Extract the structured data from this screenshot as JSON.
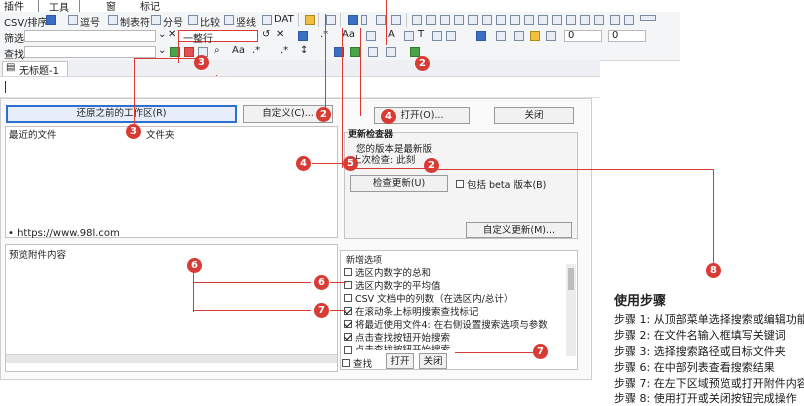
{
  "top_menu": {
    "item1": "插件",
    "item2": "工具",
    "item3": "窗",
    "item4": "标记"
  },
  "toolbar1": {
    "csv_label": "CSV/排序",
    "items": [
      "逗号",
      "制表符",
      "分号",
      "比较",
      "竖线",
      "DAT"
    ]
  },
  "filter_row": {
    "label": "筛选"
  },
  "find_row": {
    "label": "查找",
    "dropdown_value": "一整行"
  },
  "tab": {
    "label": "无标题-1"
  },
  "main": {
    "restore_button": "还原之前的工作区(R)",
    "custom_button": "自定义(C)...",
    "open_button": "打开(O)...",
    "close_button": "关闭",
    "recent_files_label": "最近的文件",
    "folder_label": "文件夹",
    "url_text": "• https://www.98l.com",
    "update_checker": {
      "title": "更新检查器",
      "latest_text": "您的版本是最新版",
      "last_check_text": "上次检查: 此刻",
      "check_button": "检查更新(U)",
      "beta_label": "包括 beta 版本(B)",
      "custom_update_button": "自定义更新(M)..."
    },
    "preview_label": "预览附件内容",
    "options": {
      "title": "新增选项",
      "items": [
        {
          "label": "选区内数字的总和",
          "checked": false
        },
        {
          "label": "选区内数字的平均值",
          "checked": false
        },
        {
          "label": "CSV 文档中的列数（在选区内/总计）",
          "checked": false
        },
        {
          "label": "在滚动条上标明搜索查找标记",
          "checked": true
        },
        {
          "label": "将最近使用文件4: 在右侧设置搜索选项与参数",
          "checked": true
        },
        {
          "label": "点击查找按钮开始搜索",
          "checked": true
        },
        {
          "label": "点击查找按钮开始搜索",
          "checked": false
        }
      ]
    },
    "bottom": {
      "find_label": "查找",
      "open_label": "打开",
      "close_label": "关闭"
    }
  },
  "badges": [
    "2",
    "2",
    "3",
    "3",
    "4",
    "4",
    "5",
    "2",
    "6",
    "6",
    "7",
    "7",
    "8",
    "2"
  ],
  "colors": {
    "accent": "#d83a34",
    "selection": "#2f6fd0"
  },
  "steps": {
    "title": "使用步骤",
    "items": [
      "步骤 1:  从顶部菜单选择搜索或编辑功能",
      "步骤 2:  在文件名输入框填写关键词",
      "步骤 3:  选择搜索路径或目标文件夹",
      "步骤 6:  在中部列表查看搜索结果",
      "步骤 7:  在左下区域预览或打开附件内容",
      "步骤 8:  使用打开或关闭按钮完成操作"
    ]
  }
}
